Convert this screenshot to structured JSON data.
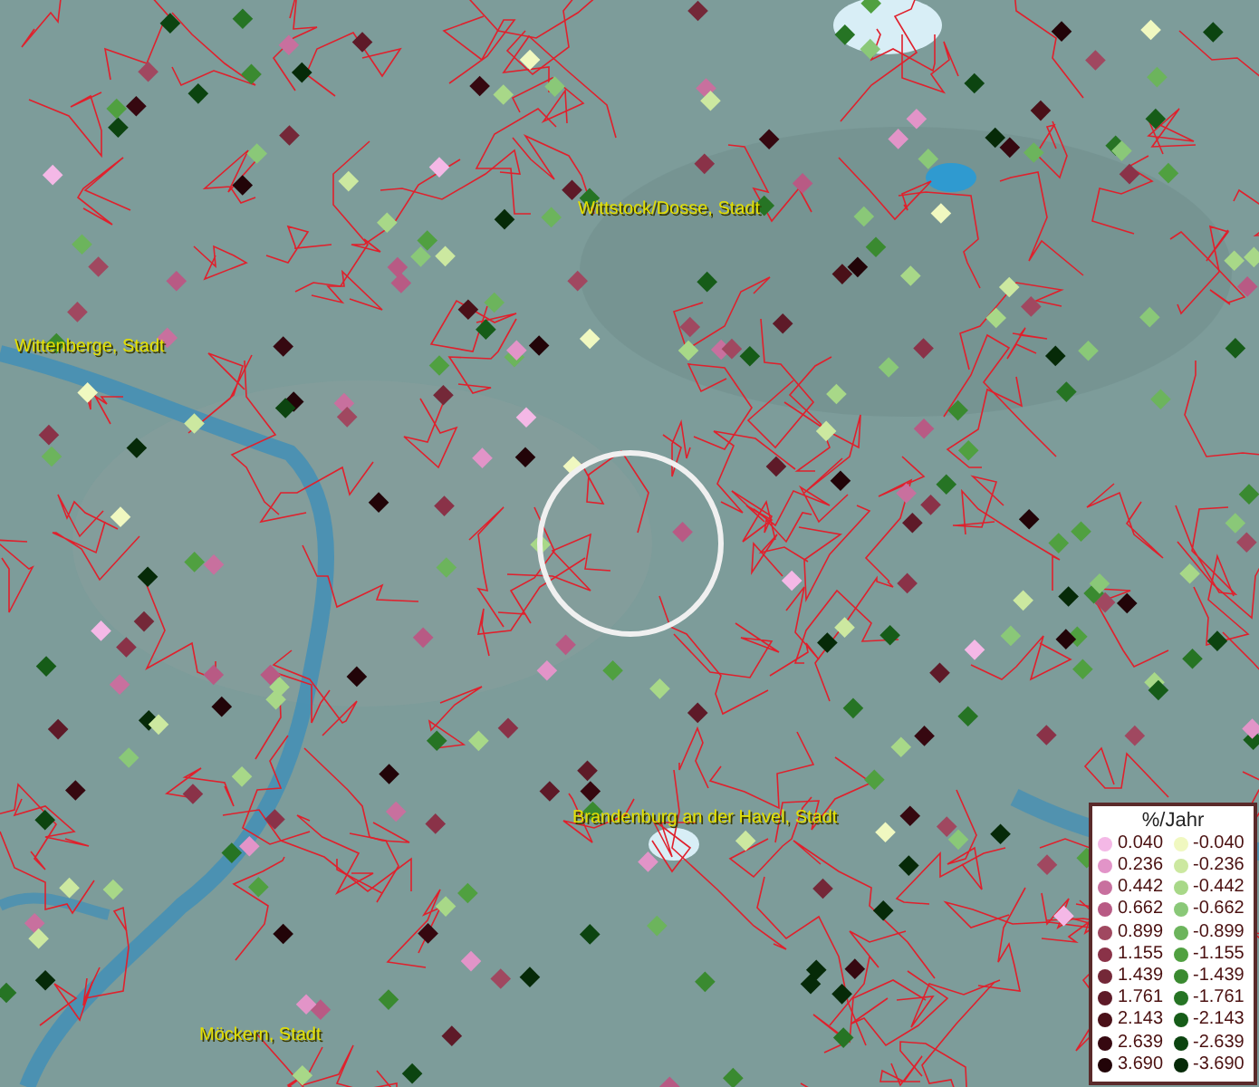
{
  "map": {
    "place_labels": [
      "Wittstock/Dosse, Stadt",
      "Wittenberge, Stadt",
      "Brandenburg an der Havel, Stadt",
      "Möckern, Stadt"
    ]
  },
  "legend": {
    "title": "%/Jahr",
    "entries": [
      {
        "positive": {
          "label": "0.040",
          "color": "#f4b8e6"
        },
        "negative": {
          "label": "-0.040",
          "color": "#f0f8c0"
        }
      },
      {
        "positive": {
          "label": "0.236",
          "color": "#e294c8"
        },
        "negative": {
          "label": "-0.236",
          "color": "#cce8a0"
        }
      },
      {
        "positive": {
          "label": "0.442",
          "color": "#c8709e"
        },
        "negative": {
          "label": "-0.442",
          "color": "#a8d888"
        }
      },
      {
        "positive": {
          "label": "0.662",
          "color": "#b85a84"
        },
        "negative": {
          "label": "-0.662",
          "color": "#8ac878"
        }
      },
      {
        "positive": {
          "label": "0.899",
          "color": "#a04860"
        },
        "negative": {
          "label": "-0.899",
          "color": "#6cb45c"
        }
      },
      {
        "positive": {
          "label": "1.155",
          "color": "#8a3248"
        },
        "negative": {
          "label": "-1.155",
          "color": "#50a040"
        }
      },
      {
        "positive": {
          "label": "1.439",
          "color": "#742838"
        },
        "negative": {
          "label": "-1.439",
          "color": "#3a8a30"
        }
      },
      {
        "positive": {
          "label": "1.761",
          "color": "#5e1a28"
        },
        "negative": {
          "label": "-1.761",
          "color": "#267424"
        }
      },
      {
        "positive": {
          "label": "2.143",
          "color": "#4a1018"
        },
        "negative": {
          "label": "-2.143",
          "color": "#165c18"
        }
      },
      {
        "positive": {
          "label": "2.639",
          "color": "#360810"
        },
        "negative": {
          "label": "-2.639",
          "color": "#0c4410"
        }
      },
      {
        "positive": {
          "label": "3.690",
          "color": "#220408"
        },
        "negative": {
          "label": "-3.690",
          "color": "#062a08"
        }
      }
    ]
  }
}
